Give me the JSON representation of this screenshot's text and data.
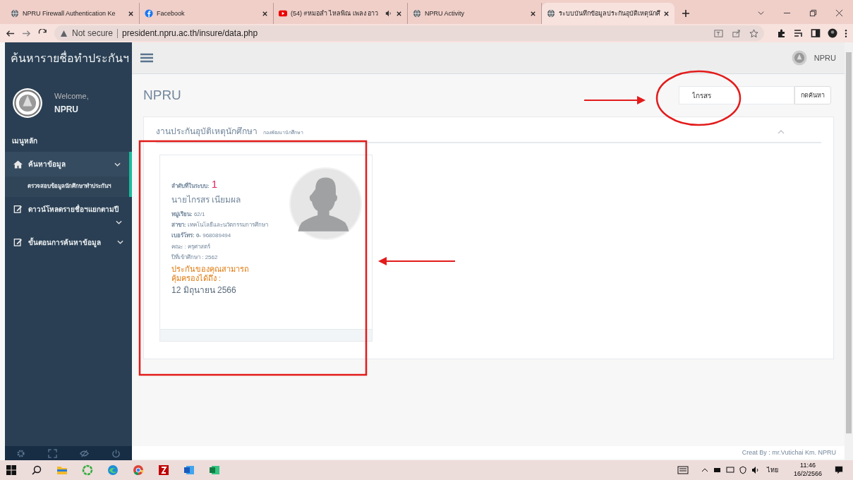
{
  "browser": {
    "tabs": [
      {
        "title": "NPRU Firewall Authentication Ke",
        "kind": "site",
        "audio": false,
        "selected": false
      },
      {
        "title": "Facebook",
        "kind": "social",
        "audio": false,
        "selected": false
      },
      {
        "title": "(54) #หมอลำ ไหลพิณ เพลง อาว",
        "kind": "video",
        "audio": true,
        "selected": false
      },
      {
        "title": "NPRU Activity",
        "kind": "site",
        "audio": false,
        "selected": false
      },
      {
        "title": "ระบบบันทึกข้อมูลประกันอุบัติเหตุนักศึ",
        "kind": "site",
        "audio": false,
        "selected": true
      }
    ],
    "address": {
      "security": "Not secure",
      "url": "president.npru.ac.th/insure/data.php"
    }
  },
  "sidebar": {
    "title": "ค้นหารายชื่อทำประกันฯ",
    "welcome": "Welcome,",
    "user": "NPRU",
    "menu_heading": "เมนูหลัก",
    "items": [
      {
        "label": "ค้นหาข้อมูล",
        "kind": "home",
        "expanded": true,
        "children": [
          {
            "label": "ตรวจสอบข้อมูลนักศึกษาทำประกันฯ",
            "selected": true
          }
        ]
      },
      {
        "label": "ดาวน์โหลดรายชื่อฯแยกตามปี",
        "kind": "edit",
        "expanded": false
      },
      {
        "label": "ขั้นตอนการค้นหาข้อมูล",
        "kind": "edit",
        "expanded": false
      }
    ]
  },
  "topbar": {
    "user": "NPRU"
  },
  "page": {
    "title": "NPRU",
    "search": {
      "value": "ไกรสร",
      "button": "กดค้นหา"
    }
  },
  "panel": {
    "title": "งานประกันอุบัติเหตุนักศึกษา",
    "subtitle": "กองพัฒนานักศึกษา",
    "record": {
      "order_label": "ลำดับที่ในระบบ:",
      "order": "1",
      "name": "นายไกรสร เนียมผล",
      "lines": [
        "**หมู่เรียน:** 62/1",
        "**สาขา:** เทคโนโลยีและนวัตกรรมการศึกษา",
        "**เบอร์โทร: 0-** 968089494",
        "คณะ : ครุศาสตร์",
        "ปีที่เข้าศึกษา : 2562"
      ],
      "coverage_label": "ประกันของคุณสามารถคุ้มครองได้ถึง :",
      "coverage_date": "12 มิถุนายน 2566"
    }
  },
  "footer": {
    "credit": "Creat By : mr.Vutichai Km. NPRU"
  },
  "taskbar": {
    "language": "ไทย",
    "time": "11:46",
    "date": "16/2/2566"
  }
}
